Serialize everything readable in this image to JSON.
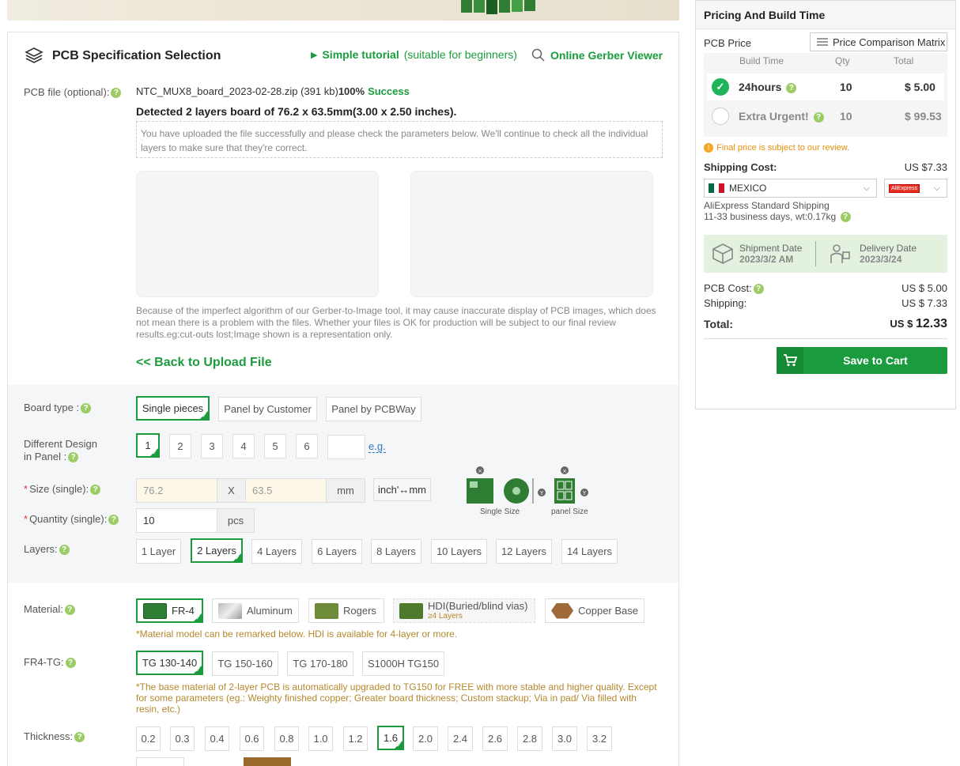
{
  "header": {
    "title": "PCB Specification Selection",
    "tutorial_label": "Simple tutorial",
    "tutorial_sub": "(suitable for beginners)",
    "gerber_viewer": "Online Gerber Viewer"
  },
  "file": {
    "label": "PCB file (optional):",
    "name": "NTC_MUX8_board_2023-02-28.zip (391 kb)",
    "percent": "100%",
    "status": "Success",
    "detected": "Detected 2 layers board of 76.2 x 63.5mm(3.00 x 2.50 inches).",
    "notice": "You have uploaded the file successfully and please check the parameters below. We'll continue to check all the individual layers to make sure that they're correct.",
    "disclaimer": "Because of the imperfect algorithm of our Gerber-to-Image tool, it may cause inaccurate display of PCB images, which does not mean there is a problem with the files. Whether your files is OK for production will be subject to our final review results.eg:cut-outs lost;Image shown is a representation only.",
    "back_link": "<< Back to Upload File"
  },
  "board_type": {
    "label": "Board type :",
    "options": [
      "Single pieces",
      "Panel by Customer",
      "Panel by PCBWay"
    ],
    "selected": "Single pieces"
  },
  "different_design": {
    "label_line1": "Different Design",
    "label_line2": "in Panel :",
    "options": [
      "1",
      "2",
      "3",
      "4",
      "5",
      "6"
    ],
    "selected": "1",
    "custom_value": "",
    "eg_link": "e.g."
  },
  "size": {
    "label": "Size (single):",
    "width": "76.2",
    "x": "X",
    "height": "63.5",
    "unit": "mm",
    "convert": "inch'↔mm",
    "single_caption": "Single Size",
    "panel_caption": "panel Size"
  },
  "quantity": {
    "label": "Quantity (single):",
    "value": "10",
    "unit": "pcs"
  },
  "layers": {
    "label": "Layers:",
    "options": [
      "1 Layer",
      "2 Layers",
      "4 Layers",
      "6 Layers",
      "8 Layers",
      "10 Layers",
      "12 Layers",
      "14 Layers"
    ],
    "selected": "2 Layers"
  },
  "material": {
    "label": "Material:",
    "options": [
      "FR-4",
      "Aluminum",
      "Rogers",
      "HDI(Buried/blind vias)",
      "Copper Base"
    ],
    "hdi_sub": "≥4 Layers",
    "selected": "FR-4",
    "note": "*Material model can be remarked below. HDI is available for 4-layer or more."
  },
  "fr4_tg": {
    "label": "FR4-TG:",
    "options": [
      "TG 130-140",
      "TG 150-160",
      "TG 170-180",
      "S1000H TG150"
    ],
    "selected": "TG 130-140",
    "note": "*The base material of 2-layer PCB is automatically upgraded to TG150 for FREE with more stable and higher quality. Except for some parameters (eg.: Weighty finished copper; Greater board thickness; Custom stackup; Via in pad/ Via filled with resin, etc.)"
  },
  "thickness": {
    "label": "Thickness:",
    "options": [
      "0.2",
      "0.3",
      "0.4",
      "0.6",
      "0.8",
      "1.0",
      "1.2",
      "1.6",
      "2.0",
      "2.4",
      "2.6",
      "2.8",
      "3.0",
      "3.2"
    ],
    "selected": "1.6"
  },
  "sidebar": {
    "title": "Pricing And Build Time",
    "pcb_price_label": "PCB Price",
    "price_matrix": "Price Comparison Matrix",
    "col_build": "Build Time",
    "col_qty": "Qty",
    "col_total": "Total",
    "rows": [
      {
        "name": "24hours",
        "qty": "10",
        "total": "$ 5.00",
        "selected": true
      },
      {
        "name": "Extra Urgent!",
        "qty": "10",
        "total": "$ 99.53",
        "selected": false
      }
    ],
    "final_note": "Final price is subject to our review.",
    "shipping_cost_label": "Shipping Cost:",
    "shipping_cost_value": "US $7.33",
    "country": "MEXICO",
    "carrier": "AliExpress",
    "shipping_method": "AliExpress Standard Shipping",
    "shipping_detail": "11-33 business days, wt:0.17kg",
    "shipment_date_label": "Shipment Date",
    "shipment_date": "2023/3/2 AM",
    "delivery_date_label": "Delivery Date",
    "delivery_date": "2023/3/24",
    "pcb_cost_label": "PCB Cost:",
    "pcb_cost_value": "US $ 5.00",
    "shipping_label": "Shipping:",
    "shipping_value": "US $ 7.33",
    "total_label": "Total:",
    "total_currency": "US $",
    "total_value": "12.33",
    "save_to_cart": "Save to Cart"
  },
  "colors": {
    "accent": "#1a9c3e",
    "note": "#b5882d",
    "required": "#e53333"
  }
}
